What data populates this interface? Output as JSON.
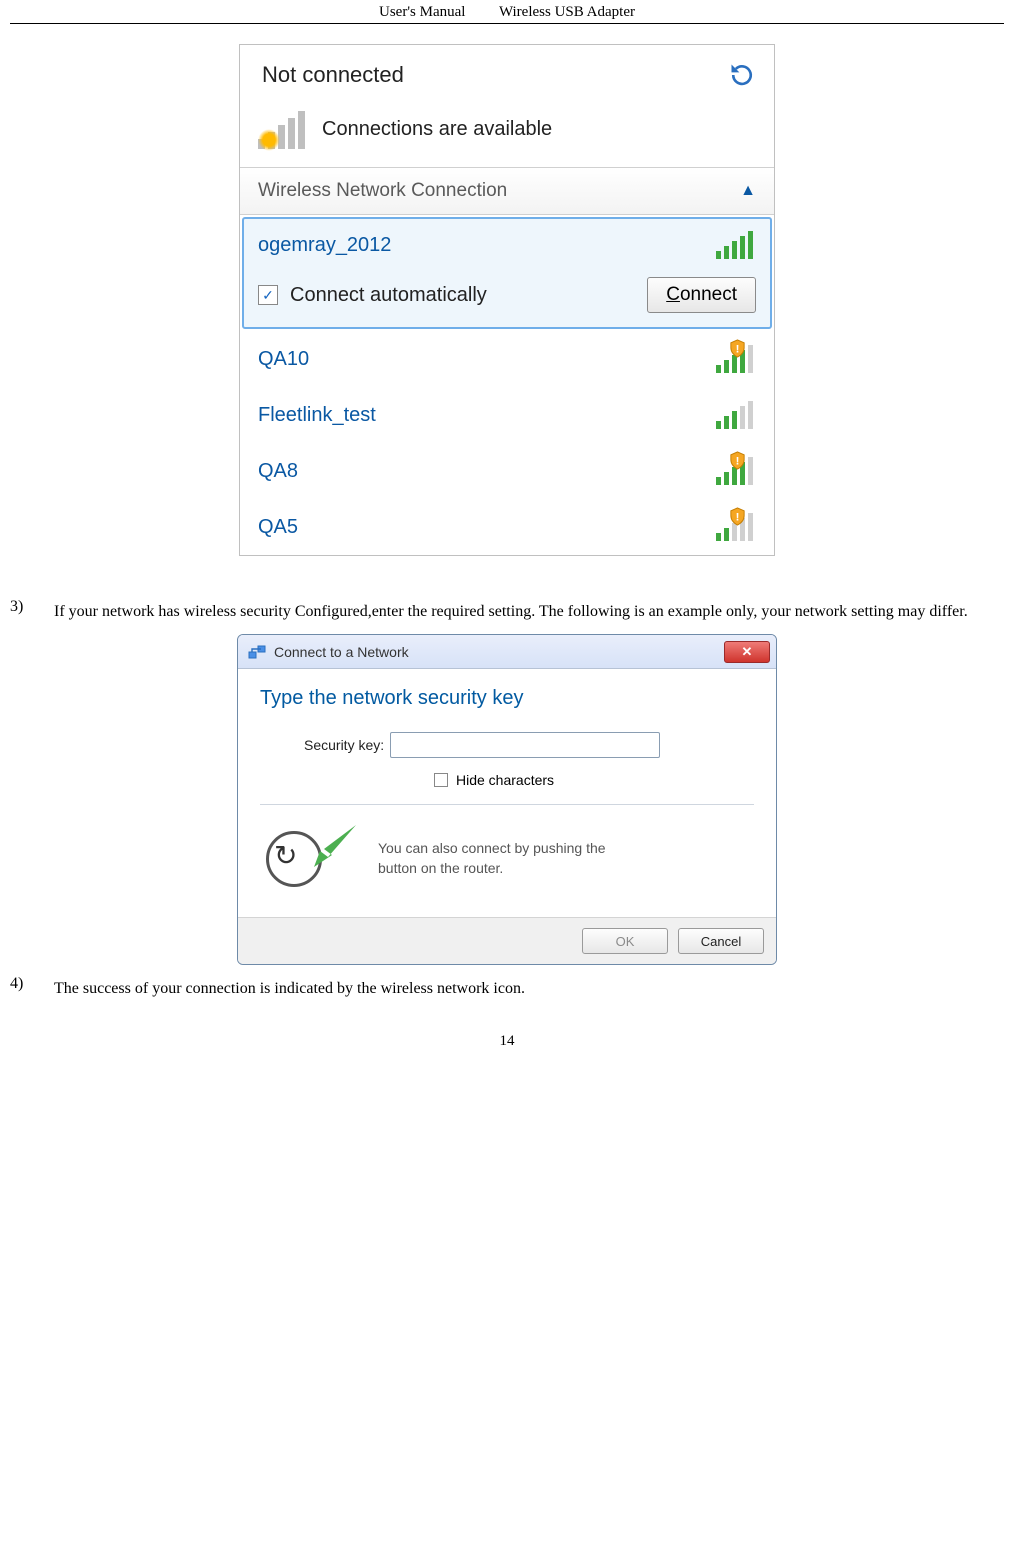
{
  "header": {
    "left": "User's Manual",
    "right": "Wireless USB Adapter"
  },
  "page_number": "14",
  "flyout": {
    "not_connected": "Not connected",
    "connections_available": "Connections are available",
    "section_header": "Wireless Network Connection",
    "auto_connect_label": "Connect automatically",
    "auto_connect_checked": true,
    "connect_button": "Connect",
    "selected_ssid": "ogemray_2012",
    "networks": [
      {
        "ssid": "QA10",
        "signal": 4,
        "secured": true
      },
      {
        "ssid": "Fleetlink_test",
        "signal": 3,
        "secured": false
      },
      {
        "ssid": "QA8",
        "signal": 4,
        "secured": true
      },
      {
        "ssid": "QA5",
        "signal": 2,
        "secured": true
      }
    ]
  },
  "body": {
    "step3_num": "3)",
    "step3_text": "If your network has wireless security Configured,enter the required setting. The following is an example only, your network setting may differ.",
    "step4_num": "4)",
    "step4_text": "The success of your connection    is indicated by the wireless network    icon."
  },
  "dialog": {
    "title": "Connect to a Network",
    "heading": "Type the network security key",
    "label_security_key": "Security key:",
    "hide_characters": "Hide characters",
    "wps_line1": "You can also connect by pushing the",
    "wps_line2": "button on the router.",
    "ok": "OK",
    "cancel": "Cancel"
  }
}
